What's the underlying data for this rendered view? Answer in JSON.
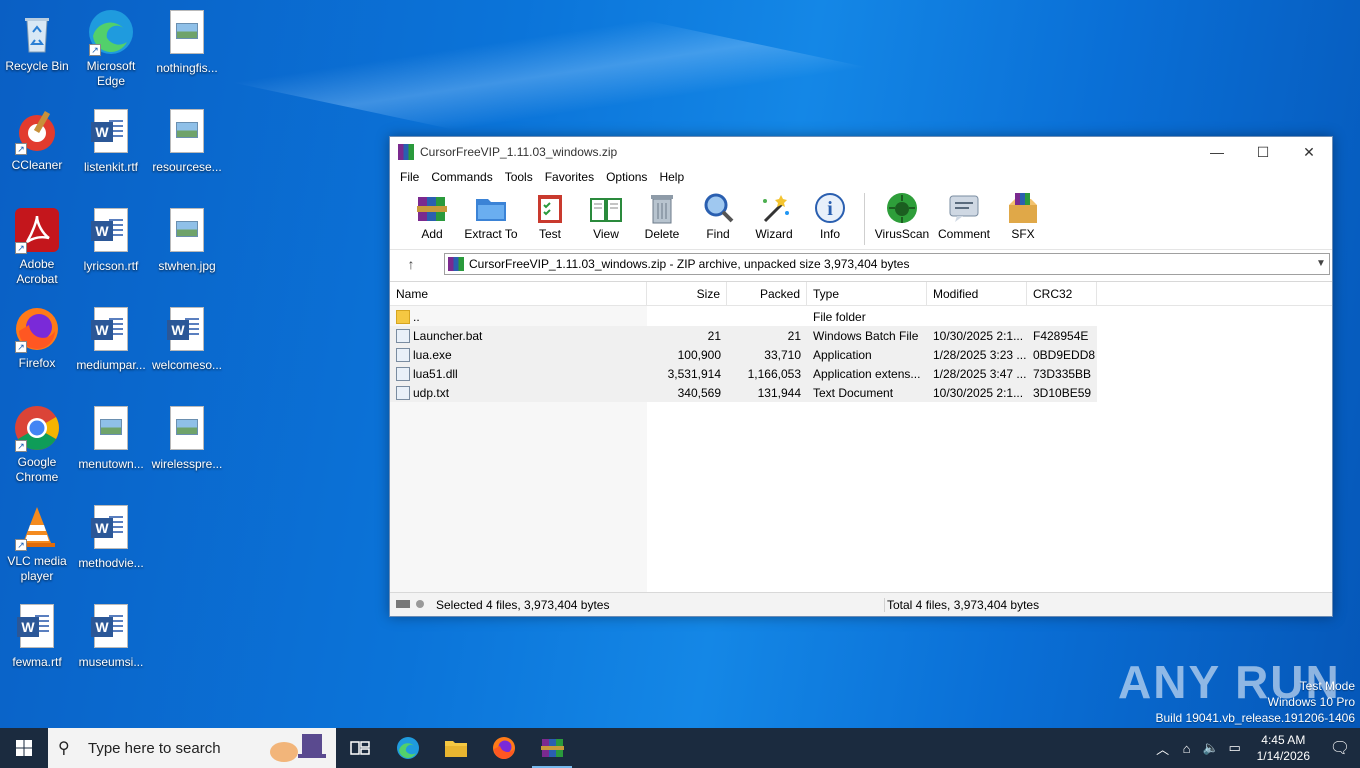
{
  "desktop": {
    "icons": [
      {
        "label": "Recycle Bin"
      },
      {
        "label": "Microsoft Edge"
      },
      {
        "label": "nothingfis..."
      },
      {
        "label": "CCleaner"
      },
      {
        "label": "listenkit.rtf"
      },
      {
        "label": "resourcese..."
      },
      {
        "label": "Adobe Acrobat"
      },
      {
        "label": "lyricson.rtf"
      },
      {
        "label": "stwhen.jpg"
      },
      {
        "label": "Firefox"
      },
      {
        "label": "mediumpar..."
      },
      {
        "label": "welcomeso..."
      },
      {
        "label": "Google Chrome"
      },
      {
        "label": "menutown..."
      },
      {
        "label": "wirelesspre..."
      },
      {
        "label": "VLC media player"
      },
      {
        "label": "methodvie..."
      },
      {
        "label": "fewma.rtf"
      },
      {
        "label": "museumsi..."
      }
    ]
  },
  "window": {
    "title": "CursorFreeVIP_1.11.03_windows.zip",
    "controls": {
      "minimize": "—",
      "maximize": "☐",
      "close": "✕"
    },
    "menu": [
      "File",
      "Commands",
      "Tools",
      "Favorites",
      "Options",
      "Help"
    ],
    "toolbar": [
      "Add",
      "Extract To",
      "Test",
      "View",
      "Delete",
      "Find",
      "Wizard",
      "Info",
      "VirusScan",
      "Comment",
      "SFX"
    ],
    "address": "CursorFreeVIP_1.11.03_windows.zip - ZIP archive, unpacked size 3,973,404 bytes",
    "columns": [
      "Name",
      "Size",
      "Packed",
      "Type",
      "Modified",
      "CRC32"
    ],
    "rows": [
      {
        "name": "..",
        "size": "",
        "packed": "",
        "type": "File folder",
        "modified": "",
        "crc": ""
      },
      {
        "name": "Launcher.bat",
        "size": "21",
        "packed": "21",
        "type": "Windows Batch File",
        "modified": "10/30/2025 2:1...",
        "crc": "F428954E"
      },
      {
        "name": "lua.exe",
        "size": "100,900",
        "packed": "33,710",
        "type": "Application",
        "modified": "1/28/2025 3:23 ...",
        "crc": "0BD9EDD8"
      },
      {
        "name": "lua51.dll",
        "size": "3,531,914",
        "packed": "1,166,053",
        "type": "Application extens...",
        "modified": "1/28/2025 3:47 ...",
        "crc": "73D335BB"
      },
      {
        "name": "udp.txt",
        "size": "340,569",
        "packed": "131,944",
        "type": "Text Document",
        "modified": "10/30/2025 2:1...",
        "crc": "3D10BE59"
      }
    ],
    "status_left": "Selected 4 files, 3,973,404 bytes",
    "status_right": "Total 4 files, 3,973,404 bytes"
  },
  "watermark": {
    "logo": "ANY RUN",
    "line1": "Test Mode",
    "line2": "Windows 10 Pro",
    "line3": "Build 19041.vb_release.191206-1406"
  },
  "taskbar": {
    "search_placeholder": "Type here to search",
    "time": "4:45 AM",
    "date": "1/14/2026"
  },
  "colors": {
    "accent": "#0078d7",
    "taskbar": "#1b2b3f"
  }
}
